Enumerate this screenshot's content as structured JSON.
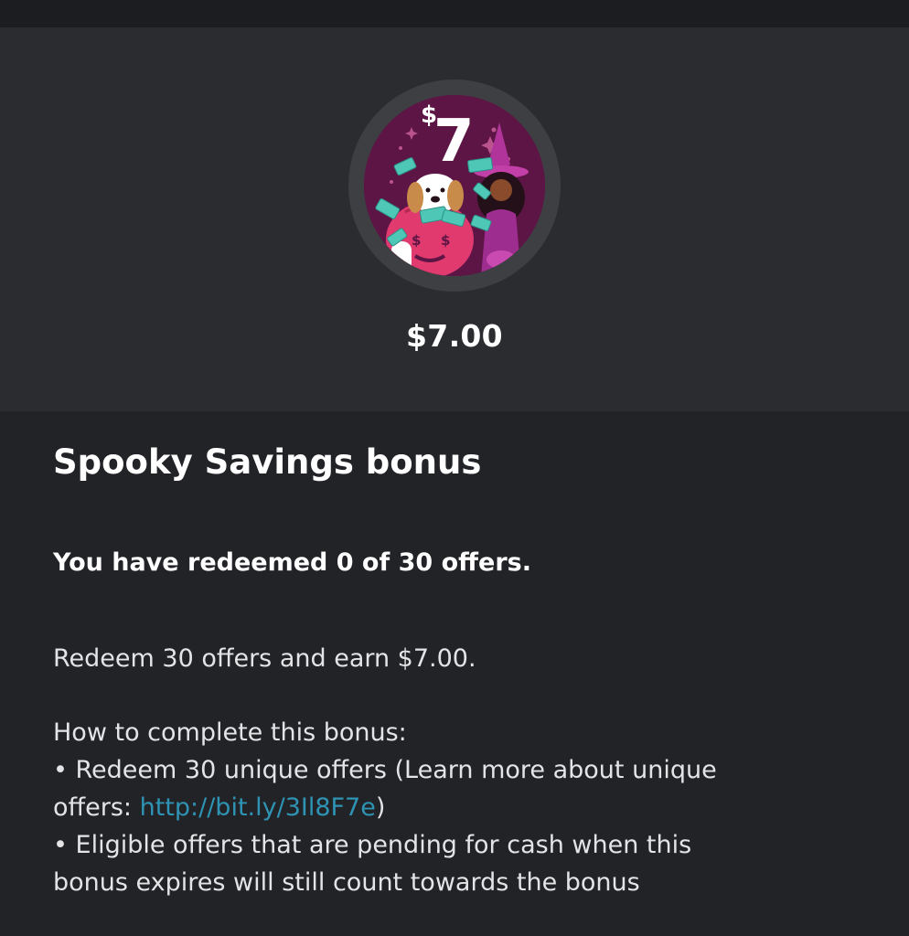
{
  "hero": {
    "badge": {
      "amount_label": "$7",
      "illustration": "spooky-savings-badge-dog-pumpkin-witch"
    },
    "amount": "$7.00"
  },
  "bonus": {
    "title": "Spooky Savings bonus",
    "progress": {
      "text": "You have redeemed 0 of 30 offers.",
      "redeemed": 0,
      "total": 30
    },
    "summary": "Redeem 30 offers and earn $7.00.",
    "how_to": {
      "heading": "How to complete this bonus:",
      "bullet1_line1": "• Redeem 30 unique offers (Learn more about unique",
      "bullet1_line2_prefix": "offers: ",
      "link_text": "http://bit.ly/3Il8F7e",
      "bullet1_line2_suffix": ")",
      "bullet2_line1": "• Eligible offers that are pending for cash when this",
      "bullet2_line2": "bonus expires will still count towards the bonus"
    }
  },
  "colors": {
    "page_bg": "#212327",
    "hero_bg": "#2a2c30",
    "link": "#2f93b3",
    "badge_bg": "#5c1545",
    "badge_pink": "#e03a6f",
    "badge_money": "#4fc7b6"
  }
}
